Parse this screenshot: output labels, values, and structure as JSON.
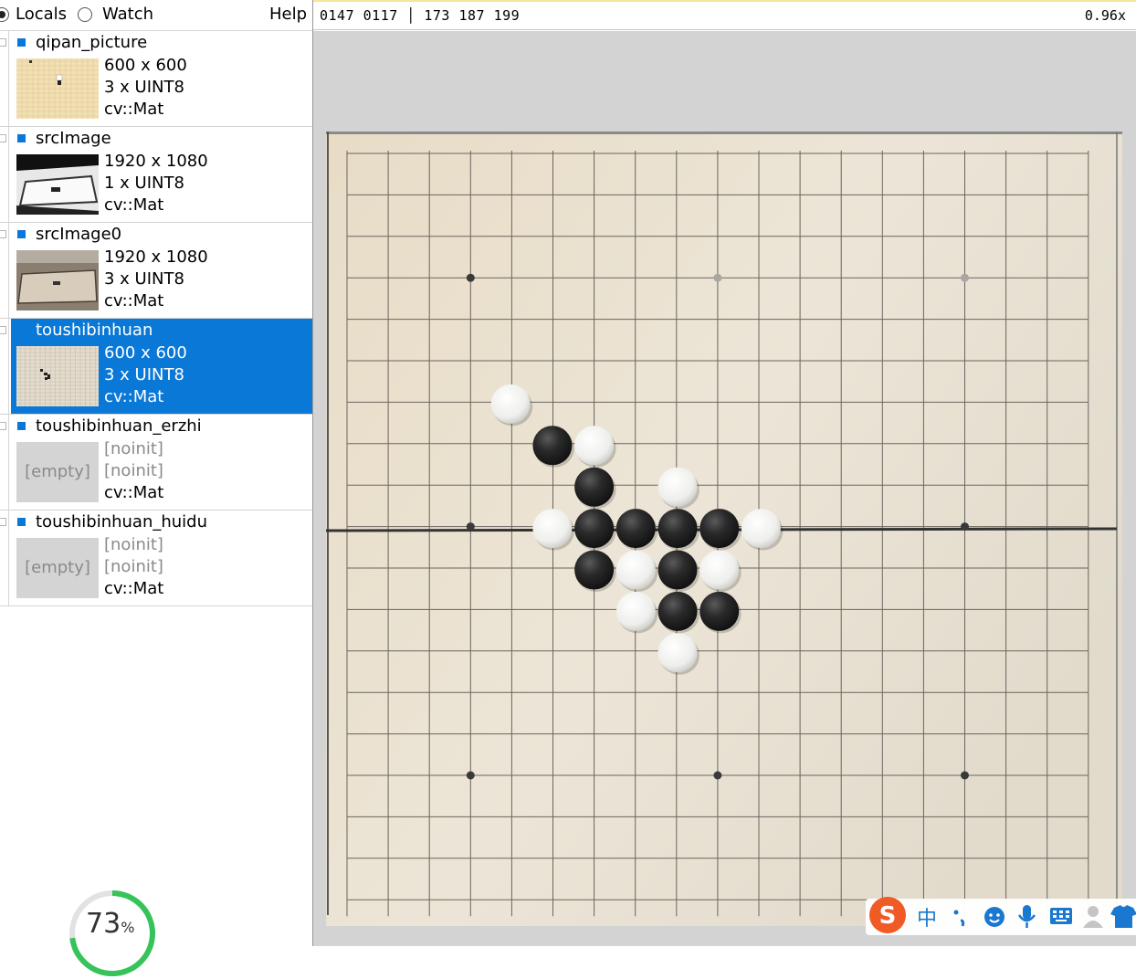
{
  "toolbar": {
    "locals_label": "Locals",
    "watch_label": "Watch",
    "help_label": "Help"
  },
  "variables": [
    {
      "name": "qipan_picture",
      "dims": "600 x 600",
      "channels": "3 x UINT8",
      "type": "cv::Mat",
      "empty": false,
      "selected": false
    },
    {
      "name": "srcImage",
      "dims": "1920 x 1080",
      "channels": "1 x UINT8",
      "type": "cv::Mat",
      "empty": false,
      "selected": false
    },
    {
      "name": "srcImage0",
      "dims": "1920 x 1080",
      "channels": "3 x UINT8",
      "type": "cv::Mat",
      "empty": false,
      "selected": false
    },
    {
      "name": "toushibinhuan",
      "dims": "600 x 600",
      "channels": "3 x UINT8",
      "type": "cv::Mat",
      "empty": false,
      "selected": true
    },
    {
      "name": "toushibinhuan_erzhi",
      "dims": "[noinit]",
      "channels": "[noinit]",
      "type": "cv::Mat",
      "empty": true,
      "empty_label": "[empty]",
      "selected": false
    },
    {
      "name": "toushibinhuan_huidu",
      "dims": "[noinit]",
      "channels": "[noinit]",
      "type": "cv::Mat",
      "empty": true,
      "empty_label": "[empty]",
      "selected": false
    }
  ],
  "viewer": {
    "pixel_readout": "0147 0117 │ 173 187 199",
    "zoom": "0.96x"
  },
  "gauge": {
    "value": "73",
    "unit": "%",
    "fraction": 0.73
  },
  "board": {
    "grid_size": 19,
    "stones": [
      {
        "color": "white",
        "col": 4,
        "row": 6
      },
      {
        "color": "black",
        "col": 5,
        "row": 7
      },
      {
        "color": "white",
        "col": 6,
        "row": 7
      },
      {
        "color": "black",
        "col": 6,
        "row": 8
      },
      {
        "color": "white",
        "col": 8,
        "row": 8
      },
      {
        "color": "white",
        "col": 5,
        "row": 9
      },
      {
        "color": "black",
        "col": 6,
        "row": 9
      },
      {
        "color": "black",
        "col": 7,
        "row": 9
      },
      {
        "color": "black",
        "col": 8,
        "row": 9
      },
      {
        "color": "black",
        "col": 9,
        "row": 9
      },
      {
        "color": "white",
        "col": 10,
        "row": 9
      },
      {
        "color": "black",
        "col": 6,
        "row": 10
      },
      {
        "color": "white",
        "col": 7,
        "row": 10
      },
      {
        "color": "black",
        "col": 8,
        "row": 10
      },
      {
        "color": "white",
        "col": 9,
        "row": 10
      },
      {
        "color": "white",
        "col": 7,
        "row": 11
      },
      {
        "color": "black",
        "col": 8,
        "row": 11
      },
      {
        "color": "black",
        "col": 9,
        "row": 11
      },
      {
        "color": "white",
        "col": 8,
        "row": 12
      }
    ]
  },
  "ime": {
    "items": [
      "sogou-logo",
      "chinese-mode",
      "punctuation",
      "emoji",
      "voice",
      "keyboard",
      "user",
      "skin"
    ],
    "chinese_char": "中"
  },
  "colors": {
    "selection": "#0a78d7",
    "gauge": "#35c35a",
    "ime_brand": "#f05a24",
    "ime_icons": "#1a78d0"
  }
}
